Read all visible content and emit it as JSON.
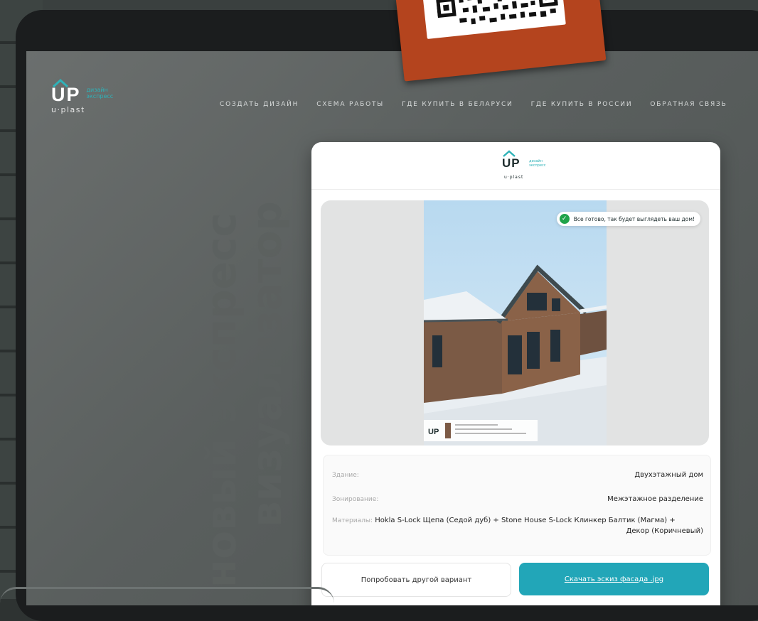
{
  "logo": {
    "letters": "UP",
    "tagline_line1": "дизайн",
    "tagline_line2": "экспресс",
    "brand": "u·plast"
  },
  "nav": [
    "СОЗДАТЬ ДИЗАЙН",
    "СХЕМА РАБОТЫ",
    "ГДЕ КУПИТЬ В БЕЛАРУСИ",
    "ГДЕ КУПИТЬ В РОССИИ",
    "ОБРАТНАЯ СВЯЗЬ"
  ],
  "watermark": {
    "line1": "новый экспресс",
    "line2": "визуализатор"
  },
  "card": {
    "logo_letters": "UP",
    "logo_tagline1": "дизайн",
    "logo_tagline2": "экспресс",
    "logo_brand": "u·plast",
    "status": "Все готово, так будет выглядеть ваш дом!",
    "info": {
      "building_label": "Здание:",
      "building_value": "Двухэтажный дом",
      "zoning_label": "Зонирование:",
      "zoning_value": "Межэтажное разделение",
      "materials_label": "Материалы:",
      "materials_value_line1": "Hokla S-Lock Щепа (Седой дуб) + Stone House S-Lock Клинкер Балтик (Магма) +",
      "materials_value_line2": "Декор (Коричневый)"
    },
    "buttons": {
      "try_other": "Попробовать другой вариант",
      "download": "Скачать эскиз фасада .jpg"
    }
  },
  "colors": {
    "accent": "#22a6b8",
    "success": "#1fa34a",
    "sticker": "#b4441e"
  }
}
